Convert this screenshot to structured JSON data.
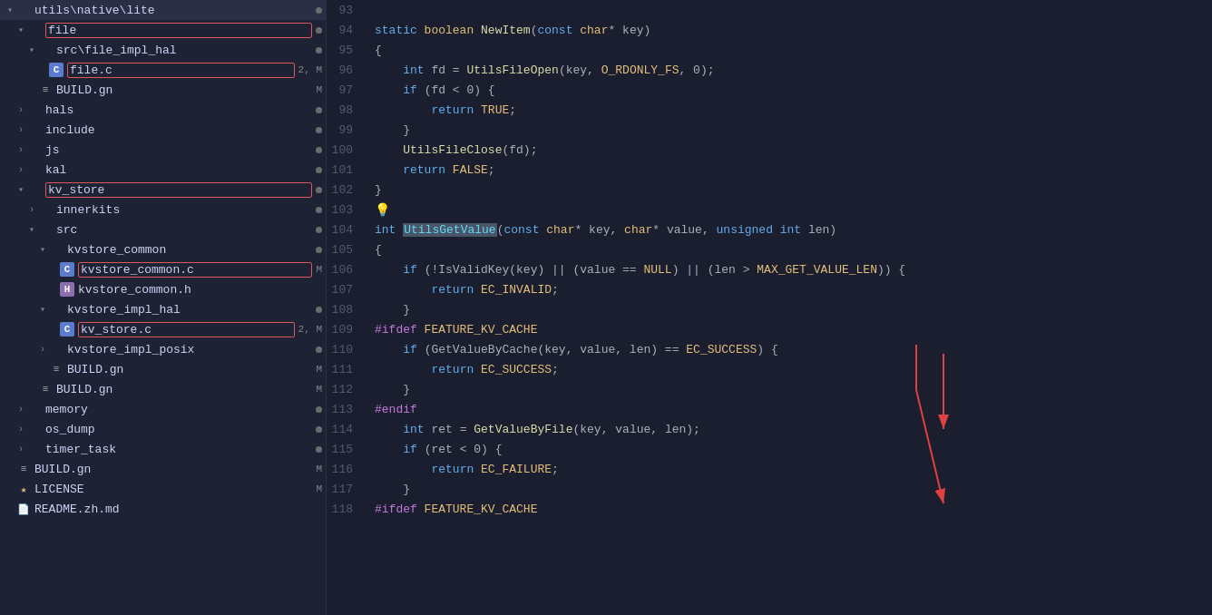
{
  "sidebar": {
    "items": [
      {
        "id": "utils-native-lite",
        "label": "utils\\native\\lite",
        "indent": 0,
        "type": "dir-open",
        "dot": true
      },
      {
        "id": "file",
        "label": "file",
        "indent": 1,
        "type": "dir-open",
        "dot": false,
        "highlighted": true
      },
      {
        "id": "src-file-impl-hal",
        "label": "src\\file_impl_hal",
        "indent": 2,
        "type": "dir-open",
        "dot": false
      },
      {
        "id": "file-c",
        "label": "file.c",
        "indent": 3,
        "type": "c-file",
        "badge": "2, M",
        "highlighted": true
      },
      {
        "id": "build-gn-1",
        "label": "BUILD.gn",
        "indent": 2,
        "type": "build",
        "badge": "M"
      },
      {
        "id": "hals",
        "label": "hals",
        "indent": 1,
        "type": "dir-closed",
        "dot": true
      },
      {
        "id": "include",
        "label": "include",
        "indent": 1,
        "type": "dir-closed",
        "dot": true
      },
      {
        "id": "js",
        "label": "js",
        "indent": 1,
        "type": "dir-closed",
        "dot": true
      },
      {
        "id": "kal",
        "label": "kal",
        "indent": 1,
        "type": "dir-closed",
        "dot": true
      },
      {
        "id": "kv-store",
        "label": "kv_store",
        "indent": 1,
        "type": "dir-open",
        "dot": false,
        "highlighted": true
      },
      {
        "id": "innerkits",
        "label": "innerkits",
        "indent": 2,
        "type": "dir-closed",
        "dot": true
      },
      {
        "id": "src",
        "label": "src",
        "indent": 2,
        "type": "dir-open",
        "dot": false
      },
      {
        "id": "kvstore-common",
        "label": "kvstore_common",
        "indent": 3,
        "type": "dir-open",
        "dot": false
      },
      {
        "id": "kvstore-common-c",
        "label": "kvstore_common.c",
        "indent": 4,
        "type": "c-file",
        "badge": "M",
        "highlighted": true
      },
      {
        "id": "kvstore-common-h",
        "label": "kvstore_common.h",
        "indent": 4,
        "type": "h-file"
      },
      {
        "id": "kvstore-impl-hal",
        "label": "kvstore_impl_hal",
        "indent": 3,
        "type": "dir-open",
        "dot": false
      },
      {
        "id": "kv-store-c",
        "label": "kv_store.c",
        "indent": 4,
        "type": "c-file",
        "badge": "2, M",
        "highlighted": true
      },
      {
        "id": "kvstore-impl-posix",
        "label": "kvstore_impl_posix",
        "indent": 3,
        "type": "dir-closed",
        "dot": true
      },
      {
        "id": "build-gn-2",
        "label": "BUILD.gn",
        "indent": 3,
        "type": "build",
        "badge": "M"
      },
      {
        "id": "build-gn-3",
        "label": "BUILD.gn",
        "indent": 2,
        "type": "build",
        "badge": "M"
      },
      {
        "id": "memory",
        "label": "memory",
        "indent": 1,
        "type": "dir-closed",
        "dot": true
      },
      {
        "id": "os-dump",
        "label": "os_dump",
        "indent": 1,
        "type": "dir-closed",
        "dot": true
      },
      {
        "id": "timer-task",
        "label": "timer_task",
        "indent": 1,
        "type": "dir-closed",
        "dot": true
      },
      {
        "id": "build-gn-main",
        "label": "BUILD.gn",
        "indent": 0,
        "type": "build",
        "badge": "M"
      },
      {
        "id": "license",
        "label": "LICENSE",
        "indent": 0,
        "type": "license",
        "badge": "M"
      },
      {
        "id": "readme",
        "label": "README.zh.md",
        "indent": 0,
        "type": "readme"
      }
    ]
  },
  "editor": {
    "lines": [
      {
        "num": 93,
        "tokens": []
      },
      {
        "num": 94,
        "tokens": [
          {
            "text": "static ",
            "cls": "kw"
          },
          {
            "text": "boolean ",
            "cls": "type"
          },
          {
            "text": "NewItem",
            "cls": "fn2"
          },
          {
            "text": "(",
            "cls": "op"
          },
          {
            "text": "const ",
            "cls": "kw"
          },
          {
            "text": "char",
            "cls": "type"
          },
          {
            "text": "* key)",
            "cls": "param"
          }
        ]
      },
      {
        "num": 95,
        "tokens": [
          {
            "text": "{",
            "cls": "op"
          }
        ]
      },
      {
        "num": 96,
        "tokens": [
          {
            "text": "    "
          },
          {
            "text": "int ",
            "cls": "kw"
          },
          {
            "text": "fd",
            "cls": "param"
          },
          {
            "text": " = ",
            "cls": "op"
          },
          {
            "text": "UtilsFileOpen",
            "cls": "fn2"
          },
          {
            "text": "(key, ",
            "cls": "param"
          },
          {
            "text": "O_RDONLY_FS",
            "cls": "const"
          },
          {
            "text": ", 0);",
            "cls": "param"
          }
        ]
      },
      {
        "num": 97,
        "tokens": [
          {
            "text": "    "
          },
          {
            "text": "if ",
            "cls": "kw"
          },
          {
            "text": "(fd < 0) {",
            "cls": "param"
          }
        ]
      },
      {
        "num": 98,
        "tokens": [
          {
            "text": "        "
          },
          {
            "text": "return ",
            "cls": "kw"
          },
          {
            "text": "TRUE",
            "cls": "const"
          },
          {
            "text": ";",
            "cls": "param"
          }
        ]
      },
      {
        "num": 99,
        "tokens": [
          {
            "text": "    "
          },
          {
            "text": "}",
            "cls": "op"
          }
        ]
      },
      {
        "num": 100,
        "tokens": [
          {
            "text": "    "
          },
          {
            "text": "UtilsFileClose",
            "cls": "fn2"
          },
          {
            "text": "(fd);",
            "cls": "param"
          }
        ]
      },
      {
        "num": 101,
        "tokens": [
          {
            "text": "    "
          },
          {
            "text": "return ",
            "cls": "kw"
          },
          {
            "text": "FALSE",
            "cls": "const"
          },
          {
            "text": ";",
            "cls": "param"
          }
        ]
      },
      {
        "num": 102,
        "tokens": [
          {
            "text": "}",
            "cls": "op"
          }
        ]
      },
      {
        "num": 103,
        "tokens": [
          {
            "text": "💡",
            "cls": "bulb"
          }
        ]
      },
      {
        "num": 104,
        "tokens": [
          {
            "text": "int ",
            "cls": "kw"
          },
          {
            "text": "UtilsGetValue",
            "cls": "fn-highlighted"
          },
          {
            "text": "(",
            "cls": "op"
          },
          {
            "text": "const ",
            "cls": "kw"
          },
          {
            "text": "char",
            "cls": "type"
          },
          {
            "text": "* key, ",
            "cls": "param"
          },
          {
            "text": "char",
            "cls": "type"
          },
          {
            "text": "* value, ",
            "cls": "param"
          },
          {
            "text": "unsigned ",
            "cls": "kw"
          },
          {
            "text": "int ",
            "cls": "kw"
          },
          {
            "text": "len)",
            "cls": "param"
          }
        ]
      },
      {
        "num": 105,
        "tokens": [
          {
            "text": "{",
            "cls": "op"
          }
        ]
      },
      {
        "num": 106,
        "tokens": [
          {
            "text": "    "
          },
          {
            "text": "if ",
            "cls": "kw"
          },
          {
            "text": "(!IsValidKey(key) || (value == ",
            "cls": "param"
          },
          {
            "text": "NULL",
            "cls": "const"
          },
          {
            "text": ") || (len > ",
            "cls": "param"
          },
          {
            "text": "MAX_GET_VALUE_LEN",
            "cls": "const"
          },
          {
            "text": ")) {",
            "cls": "param"
          }
        ]
      },
      {
        "num": 107,
        "tokens": [
          {
            "text": "        "
          },
          {
            "text": "return ",
            "cls": "kw"
          },
          {
            "text": "EC_INVALID",
            "cls": "const"
          },
          {
            "text": ";",
            "cls": "param"
          }
        ]
      },
      {
        "num": 108,
        "tokens": [
          {
            "text": "    "
          },
          {
            "text": "}",
            "cls": "op"
          }
        ]
      },
      {
        "num": 109,
        "tokens": [
          {
            "text": "#ifdef ",
            "cls": "pp"
          },
          {
            "text": "FEATURE_KV_CACHE",
            "cls": "const"
          }
        ]
      },
      {
        "num": 110,
        "tokens": [
          {
            "text": "    "
          },
          {
            "text": "if ",
            "cls": "kw"
          },
          {
            "text": "(GetValueByCache(key, value, len) == ",
            "cls": "param"
          },
          {
            "text": "EC_SUCCESS",
            "cls": "const"
          },
          {
            "text": ") {",
            "cls": "param"
          }
        ]
      },
      {
        "num": 111,
        "tokens": [
          {
            "text": "        "
          },
          {
            "text": "return ",
            "cls": "kw"
          },
          {
            "text": "EC_SUCCESS",
            "cls": "const"
          },
          {
            "text": ";",
            "cls": "param"
          }
        ]
      },
      {
        "num": 112,
        "tokens": [
          {
            "text": "    "
          },
          {
            "text": "}",
            "cls": "op"
          }
        ]
      },
      {
        "num": 113,
        "tokens": [
          {
            "text": "#endif",
            "cls": "pp"
          }
        ]
      },
      {
        "num": 114,
        "tokens": [
          {
            "text": "    "
          },
          {
            "text": "int ",
            "cls": "kw"
          },
          {
            "text": "ret",
            "cls": "param"
          },
          {
            "text": " = ",
            "cls": "op"
          },
          {
            "text": "GetValueByFile",
            "cls": "fn2"
          },
          {
            "text": "(key, value, len);",
            "cls": "param"
          }
        ]
      },
      {
        "num": 115,
        "tokens": [
          {
            "text": "    "
          },
          {
            "text": "if ",
            "cls": "kw"
          },
          {
            "text": "(ret < 0) {",
            "cls": "param"
          }
        ]
      },
      {
        "num": 116,
        "tokens": [
          {
            "text": "        "
          },
          {
            "text": "return ",
            "cls": "kw"
          },
          {
            "text": "EC_FAILURE",
            "cls": "const"
          },
          {
            "text": ";",
            "cls": "param"
          }
        ]
      },
      {
        "num": 117,
        "tokens": [
          {
            "text": "    "
          },
          {
            "text": "}",
            "cls": "op"
          }
        ]
      },
      {
        "num": 118,
        "tokens": [
          {
            "text": "#ifdef ",
            "cls": "pp"
          },
          {
            "text": "FEATURE_KV_CACHE",
            "cls": "const"
          }
        ]
      }
    ]
  }
}
